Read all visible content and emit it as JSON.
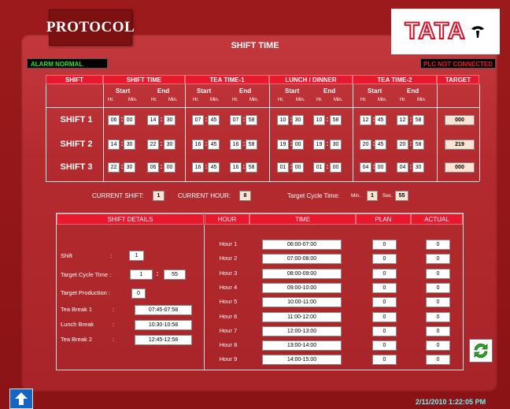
{
  "logos": {
    "protocol": "PROTOCOL",
    "tata": "TATA"
  },
  "title": "SHIFT TIME",
  "status": {
    "alarm": "ALARM NORMAL",
    "plc": "PLC NOT CONNECTED"
  },
  "headers": {
    "shift": "SHIFT",
    "shift_time": "SHIFT TIME",
    "tea1": "TEA TIME-1",
    "lunch": "LUNCH / DINNER",
    "tea2": "TEA TIME-2",
    "target": "TARGET"
  },
  "sub": {
    "start": "Start",
    "end": "End",
    "hr": "Hr.",
    "min": "Min."
  },
  "shifts": [
    {
      "label": "SHIFT 1",
      "st": [
        "06",
        "00",
        "14",
        "30"
      ],
      "t1": [
        "07",
        "45",
        "07",
        "58"
      ],
      "ld": [
        "10",
        "30",
        "10",
        "58"
      ],
      "t2": [
        "12",
        "45",
        "12",
        "58"
      ],
      "target": "000"
    },
    {
      "label": "SHIFT 2",
      "st": [
        "14",
        "30",
        "22",
        "30"
      ],
      "t1": [
        "16",
        "45",
        "16",
        "58"
      ],
      "ld": [
        "19",
        "00",
        "19",
        "30"
      ],
      "t2": [
        "20",
        "45",
        "20",
        "58"
      ],
      "target": "219"
    },
    {
      "label": "SHIFT 3",
      "st": [
        "22",
        "30",
        "06",
        "00"
      ],
      "t1": [
        "16",
        "45",
        "16",
        "58"
      ],
      "ld": [
        "01",
        "00",
        "01",
        "00"
      ],
      "t2": [
        "04",
        "00",
        "04",
        "30"
      ],
      "target": "000"
    }
  ],
  "current": {
    "shift_label": "CURRENT SHIFT:",
    "shift": "1",
    "hour_label": "CURRENT HOUR:",
    "hour": "8",
    "cycle_label": "Target Cycle Time:",
    "min_label": "Min.",
    "min": "1",
    "sec_label": "Sec.",
    "sec": "55"
  },
  "details": {
    "header": "SHIFT DETAILS",
    "shift_label": "Shift",
    "shift": "1",
    "cycle_label": "Target Cycle Time :",
    "cycle_min": "1",
    "cycle_sec": "55",
    "prod_label": "Target Production :",
    "prod": "0",
    "tea1_label": "Tea Break 1",
    "tea1": "07:45-07:58",
    "lunch_label": "Lunch Break",
    "lunch": "10:30-10:58",
    "tea2_label": "Tea Break 2",
    "tea2": "12:45-12:58"
  },
  "hours_table": {
    "headers": {
      "hour": "HOUR",
      "time": "TIME",
      "plan": "PLAN",
      "actual": "ACTUAL"
    },
    "rows": [
      {
        "hour": "Hour 1",
        "time": "06:00-07:00",
        "plan": "0",
        "actual": "0"
      },
      {
        "hour": "Hour 2",
        "time": "07:00-08:00",
        "plan": "0",
        "actual": "0"
      },
      {
        "hour": "Hour 3",
        "time": "08:00-09:00",
        "plan": "0",
        "actual": "0"
      },
      {
        "hour": "Hour 4",
        "time": "09:00-10:00",
        "plan": "0",
        "actual": "0"
      },
      {
        "hour": "Hour 5",
        "time": "10:00-11:00",
        "plan": "0",
        "actual": "0"
      },
      {
        "hour": "Hour 6",
        "time": "11:00-12:00",
        "plan": "0",
        "actual": "0"
      },
      {
        "hour": "Hour 7",
        "time": "12:00-13:00",
        "plan": "0",
        "actual": "0"
      },
      {
        "hour": "Hour 8",
        "time": "13:00-14:00",
        "plan": "0",
        "actual": "0"
      },
      {
        "hour": "Hour 9",
        "time": "14:00-15:00",
        "plan": "0",
        "actual": "0"
      }
    ]
  },
  "datetime": "2/11/2010  1:22:05 PM",
  "icons": {
    "refresh": "refresh-icon",
    "home": "up-arrow-icon"
  },
  "colors": {
    "header_red": "#e8182f",
    "alarm_green": "#2fe12f",
    "plc_red": "#e02222",
    "datetime_cyan": "#6ff0f2"
  }
}
